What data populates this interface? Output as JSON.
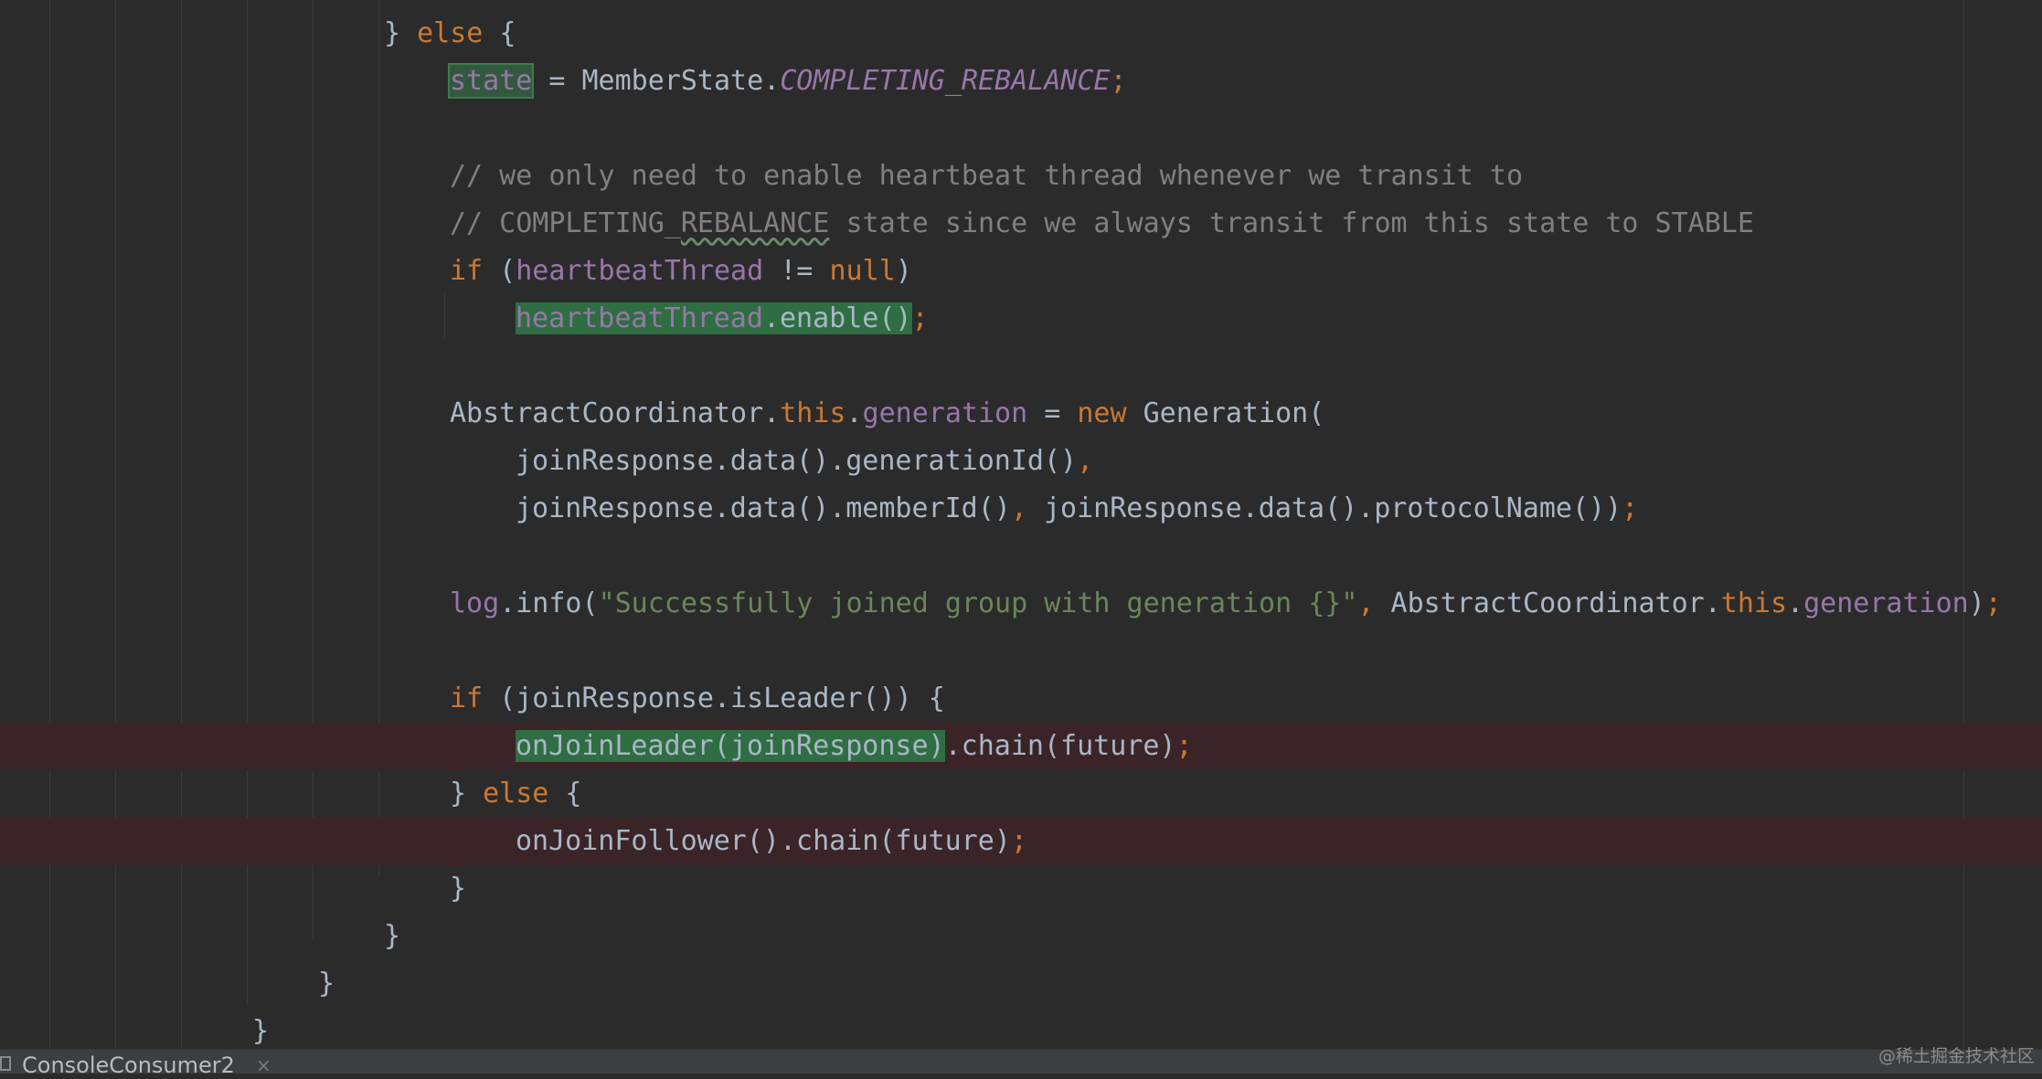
{
  "editor": {
    "lines": {
      "l1": {
        "t1": "} ",
        "t2": "else",
        "t3": " {"
      },
      "l2": {
        "t1": "state",
        "t2": " = ",
        "t3": "MemberState.",
        "t4": "COMPLETING_REBALANCE",
        "t5": ";"
      },
      "l4": {
        "t1": "// we only need to enable heartbeat thread whenever we transit to"
      },
      "l5": {
        "t1": "// COMPLETING_",
        "t2": "REBALANCE",
        "t3": " state since we always transit from this state to STABLE"
      },
      "l6": {
        "t1": "if",
        "t2": " (",
        "t3": "heartbeatThread",
        "t4": " != ",
        "t5": "null",
        "t6": ")"
      },
      "l7": {
        "t1": "heartbeatThread",
        "t2": ".enable()",
        "t3": ";"
      },
      "l9": {
        "t1": "AbstractCoordinator.",
        "t2": "this",
        "t3": ".",
        "t4": "generation",
        "t5": " = ",
        "t6": "new",
        "t7": " Generation("
      },
      "l10": {
        "t1": "joinResponse.data().generationId()",
        "t2": ","
      },
      "l11": {
        "t1": "joinResponse.data().memberId()",
        "t2": ",",
        "t3": " joinResponse.data().protocolName())",
        "t4": ";"
      },
      "l13": {
        "t1": "log",
        "t2": ".info(",
        "t3": "\"Successfully joined group with generation {}\"",
        "t4": ",",
        "t5": " AbstractCoordinator.",
        "t6": "this",
        "t7": ".",
        "t8": "generation",
        "t9": ")",
        "t10": ";"
      },
      "l15": {
        "t1": "if",
        "t2": " (joinResponse.isLeader()) {"
      },
      "l16": {
        "t1": "onJoinLeader(joinResponse)",
        "t2": ".chain(future)",
        "t3": ";"
      },
      "l17": {
        "t1": "} ",
        "t2": "else",
        "t3": " {"
      },
      "l18": {
        "t1": "onJoinFollower().chain(future)",
        "t2": ";"
      },
      "l19": {
        "t1": "}"
      },
      "l20": {
        "t1": "}"
      },
      "l21": {
        "t1": "}"
      },
      "l22": {
        "t1": "}"
      }
    }
  },
  "bottom_bar": {
    "tab_label": "ConsoleConsumer2",
    "tab_close": "×"
  },
  "watermark": "@稀土掘金技术社区",
  "colors": {
    "background": "#2b2b2b",
    "keyword": "#cc7832",
    "field": "#9876aa",
    "comment": "#808080",
    "string": "#6a8759",
    "text": "#a9b7c6",
    "breakpoint_line": "#3b2428",
    "highlight": "#2e6e42"
  }
}
